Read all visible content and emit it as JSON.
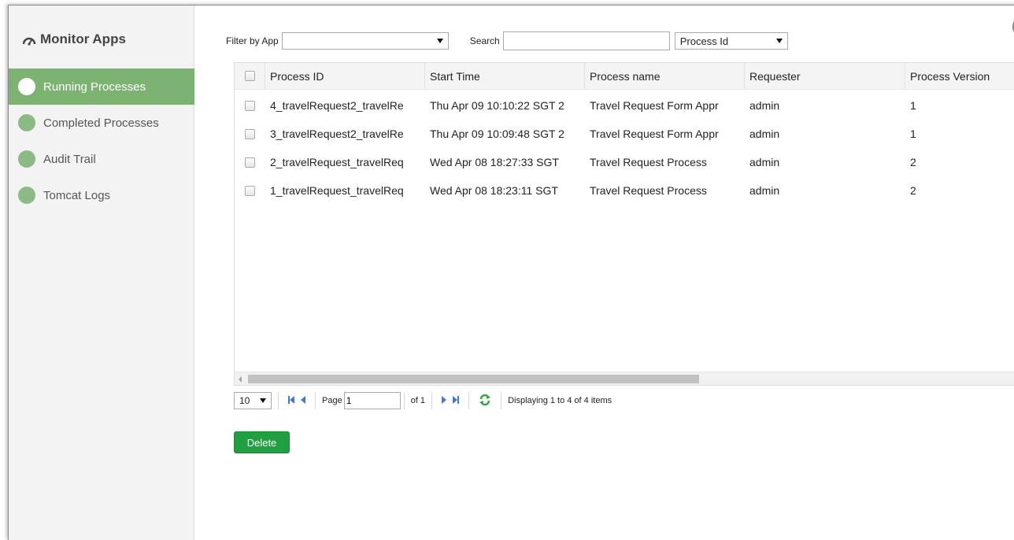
{
  "sidebar": {
    "title": "Monitor Apps",
    "title_icon": "dashboard-icon",
    "items": [
      {
        "label": "Running Processes",
        "active": true
      },
      {
        "label": "Completed Processes",
        "active": false
      },
      {
        "label": "Audit Trail",
        "active": false
      },
      {
        "label": "Tomcat Logs",
        "active": false
      }
    ]
  },
  "filter": {
    "app_label": "Filter by App",
    "app_value": "",
    "search_label": "Search",
    "search_value": "",
    "search_field_value": "Process Id"
  },
  "grid": {
    "columns": [
      "Process ID",
      "Start Time",
      "Process name",
      "Requester",
      "Process Version"
    ],
    "rows": [
      [
        "4_travelRequest2_travelRe",
        "Thu Apr 09 10:10:22 SGT 2",
        "Travel Request Form Appr",
        "admin",
        "1"
      ],
      [
        "3_travelRequest2_travelRe",
        "Thu Apr 09 10:09:48 SGT 2",
        "Travel Request Form Appr",
        "admin",
        "1"
      ],
      [
        "2_travelRequest_travelReq",
        "Wed Apr 08 18:27:33 SGT",
        "Travel Request Process",
        "admin",
        "2"
      ],
      [
        "1_travelRequest_travelReq",
        "Wed Apr 08 18:23:11 SGT",
        "Travel Request Process",
        "admin",
        "2"
      ]
    ]
  },
  "pager": {
    "page_size": "10",
    "page_label": "Page",
    "page_value": "1",
    "of_label": "of 1",
    "display_text": "Displaying 1 to 4 of 4 items"
  },
  "actions": {
    "delete_label": "Delete"
  },
  "colors": {
    "accent_green": "#7db372",
    "delete_green": "#20a040",
    "pager_blue": "#3a7bd5"
  }
}
